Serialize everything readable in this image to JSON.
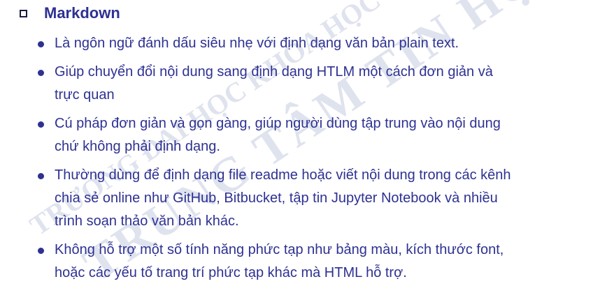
{
  "title": "Markdown",
  "bullets": [
    {
      "lines": [
        "Là ngôn ngữ đánh dấu siêu nhẹ với định dạng văn bản plain text."
      ]
    },
    {
      "lines": [
        "Giúp chuyển đổi nội dung sang định dạng HTLM một cách đơn giản và",
        "trực quan"
      ]
    },
    {
      "lines": [
        "Cú pháp đơn giản và gọn gàng, giúp người dùng tập trung vào nội dung",
        "chứ không phải định dạng."
      ]
    },
    {
      "lines": [
        "Thường dùng để định dạng file readme hoặc viết nội dung trong các kênh",
        "chia sẻ online như GitHub, Bitbucket, tập tin Jupyter Notebook và nhiều",
        "trình soạn thảo văn bản khác."
      ]
    },
    {
      "lines": [
        "Không hỗ trợ một số tính năng phức tạp như bảng màu, kích thước font,",
        "hoặc các yếu tố trang trí phức tạp khác mà HTML hỗ trợ."
      ]
    }
  ],
  "watermark": {
    "line1": "TRƯỜNG ĐẠI HỌC KHOA HỌC TỰ NHIÊN",
    "line2": "TRUNG TÂM TIN HỌC"
  },
  "colors": {
    "text": "#2e3192",
    "watermark": "#dfe3ee"
  }
}
